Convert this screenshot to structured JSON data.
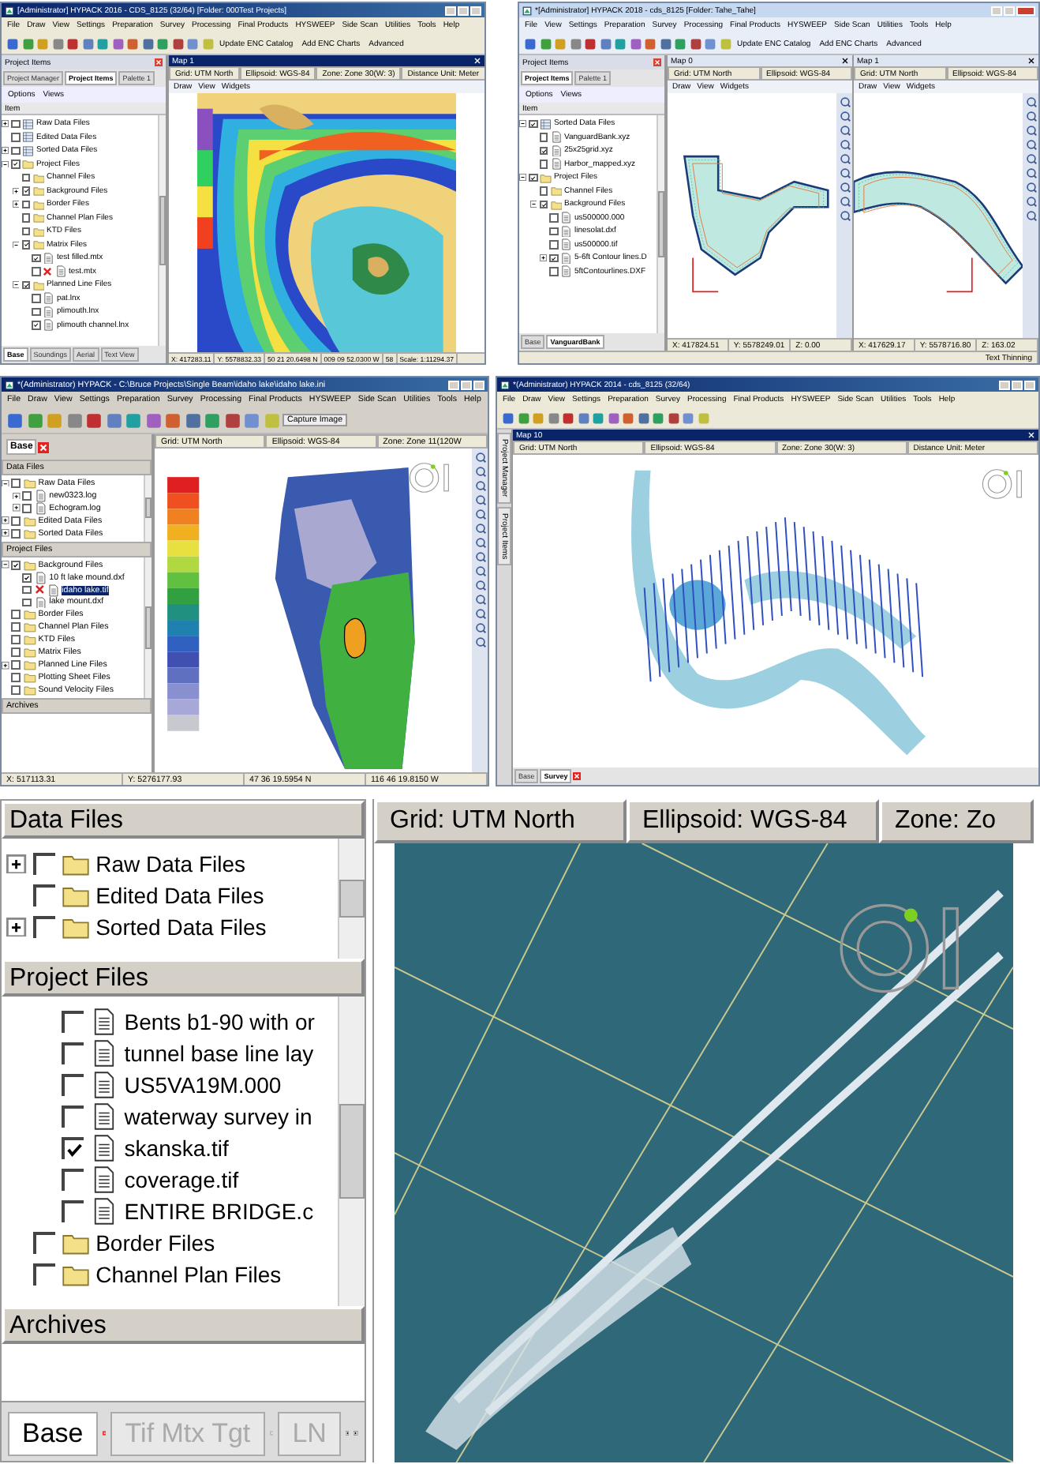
{
  "screens": [
    {
      "kind": "window",
      "title": "[Administrator] HYPACK 2016 - CDS_8125 (32/64) [Folder: 000Test Projects]",
      "menu": [
        "File",
        "Draw",
        "View",
        "Settings",
        "Preparation",
        "Survey",
        "Processing",
        "Final Products",
        "HYSWEEP",
        "Side Scan",
        "Utilities",
        "Tools",
        "Help"
      ],
      "toolbar_labels": [
        "Update ENC Catalog",
        "Add ENC Charts",
        "Advanced"
      ],
      "panel": {
        "title": "Project Items",
        "tabs": [
          {
            "label": "Project Manager",
            "selected": false
          },
          {
            "label": "Project Items",
            "selected": true
          },
          {
            "label": "Palette 1",
            "selected": false
          }
        ],
        "options": [
          "Options",
          "Views"
        ],
        "header": "Item",
        "sections": [
          {
            "tree": [
              {
                "label": "Raw Data Files",
                "kind": "data",
                "checked": false,
                "expanded": false
              },
              {
                "label": "Edited Data Files",
                "kind": "data",
                "checked": false
              },
              {
                "label": "Sorted Data Files",
                "kind": "data",
                "checked": false,
                "expanded": false
              },
              {
                "label": "Project Files",
                "kind": "folder",
                "checked": true,
                "expanded": true,
                "children": [
                  {
                    "label": "Channel Files",
                    "kind": "folder",
                    "checked": false
                  },
                  {
                    "label": "Background Files",
                    "kind": "folder",
                    "checked": true,
                    "expanded": false
                  },
                  {
                    "label": "Border Files",
                    "kind": "folder",
                    "checked": false,
                    "expanded": false
                  },
                  {
                    "label": "Channel Plan Files",
                    "kind": "folder",
                    "checked": false
                  },
                  {
                    "label": "KTD Files",
                    "kind": "folder",
                    "checked": false
                  },
                  {
                    "label": "Matrix Files",
                    "kind": "folder",
                    "checked": true,
                    "expanded": true,
                    "children": [
                      {
                        "label": "test filled.mtx",
                        "kind": "file",
                        "checked": true
                      },
                      {
                        "label": "test.mtx",
                        "kind": "file",
                        "checked": false,
                        "missing": true
                      }
                    ]
                  },
                  {
                    "label": "Planned Line Files",
                    "kind": "folder",
                    "checked": true,
                    "expanded": true,
                    "children": [
                      {
                        "label": "pat.lnx",
                        "kind": "file",
                        "checked": false
                      },
                      {
                        "label": "plimouth.lnx",
                        "kind": "file",
                        "checked": false
                      },
                      {
                        "label": "plimouth channel.lnx",
                        "kind": "file",
                        "checked": true
                      }
                    ]
                  }
                ]
              }
            ]
          }
        ],
        "bottom_tabs": [
          {
            "label": "Base",
            "selected": true
          },
          {
            "label": "Soundings",
            "selected": false
          },
          {
            "label": "Aerial",
            "selected": false
          },
          {
            "label": "Text View",
            "selected": false
          }
        ]
      },
      "maps": [
        {
          "title": "Map 1",
          "fields": [
            "Grid: UTM North",
            "Ellipsoid: WGS-84",
            "Zone: Zone 30(W: 3)",
            "Distance Unit: Meter"
          ],
          "tools": [
            "Draw",
            "View",
            "Widgets"
          ],
          "kind": "depth",
          "status": [
            "X: 417283.11",
            "Y: 5578832.33",
            "50 21 20.6498 N",
            "009 09 52.0300 W",
            "58",
            "Scale: 1:11294.37"
          ]
        }
      ]
    },
    {
      "kind": "window",
      "title": "*[Administrator] HYPACK 2018 - cds_8125 [Folder: Tahe_Tahe]",
      "menu": [
        "File",
        "View",
        "Settings",
        "Preparation",
        "Survey",
        "Processing",
        "Final Products",
        "HYSWEEP",
        "Side Scan",
        "Utilities",
        "Tools",
        "Help"
      ],
      "toolbar_labels": [
        "Update ENC Catalog",
        "Add ENC Charts",
        "Advanced"
      ],
      "panel": {
        "title": "Project Items",
        "tabs": [
          {
            "label": "Project Items",
            "selected": true
          },
          {
            "label": "Palette 1",
            "selected": false
          }
        ],
        "options": [
          "Options",
          "Views"
        ],
        "header": "Item",
        "sections": [
          {
            "tree": [
              {
                "label": "Sorted Data Files",
                "kind": "data",
                "checked": true,
                "expanded": true,
                "children": [
                  {
                    "label": "VanguardBank.xyz",
                    "kind": "file",
                    "checked": false
                  },
                  {
                    "label": "25x25grid.xyz",
                    "kind": "file",
                    "checked": true
                  },
                  {
                    "label": "Harbor_mapped.xyz",
                    "kind": "file",
                    "checked": false
                  }
                ]
              },
              {
                "label": "Project Files",
                "kind": "folder",
                "checked": true,
                "expanded": true,
                "children": [
                  {
                    "label": "Channel Files",
                    "kind": "folder",
                    "checked": false
                  },
                  {
                    "label": "Background Files",
                    "kind": "folder",
                    "checked": true,
                    "expanded": true,
                    "children": [
                      {
                        "label": "us500000.000",
                        "kind": "file",
                        "checked": false
                      },
                      {
                        "label": "linesolat.dxf",
                        "kind": "file",
                        "checked": false
                      },
                      {
                        "label": "us500000.tif",
                        "kind": "file",
                        "checked": false
                      },
                      {
                        "label": "5-6ft Contour lines.D",
                        "kind": "file",
                        "checked": true,
                        "expanded": false
                      },
                      {
                        "label": "5ftContourlines.DXF",
                        "kind": "file",
                        "checked": false
                      }
                    ]
                  }
                ]
              }
            ]
          }
        ],
        "bottom_tabs": [
          {
            "label": "Base",
            "selected": false
          },
          {
            "label": "VanguardBank",
            "selected": true
          }
        ]
      },
      "maps": [
        {
          "title": "Map 0",
          "fields": [
            "Grid: UTM North",
            "Ellipsoid: WGS-84"
          ],
          "tools": [
            "Draw",
            "View",
            "Widgets"
          ],
          "kind": "contour",
          "status": [
            "X: 417824.51",
            "Y: 5578249.01",
            "Z: 0.00"
          ]
        },
        {
          "title": "Map 1",
          "fields": [
            "Grid: UTM North",
            "Ellipsoid: WGS-84"
          ],
          "tools": [
            "Draw",
            "View",
            "Widgets"
          ],
          "kind": "contour",
          "status": [
            "X: 417629.17",
            "Y: 5578716.80",
            "Z: 163.02"
          ]
        }
      ],
      "status": [
        "Text Thinning"
      ]
    },
    {
      "kind": "window",
      "title": "*(Administrator) HYPACK - C:\\Bruce Projects\\Single Beam\\idaho lake\\idaho lake.ini",
      "menu": [
        "File",
        "Draw",
        "View",
        "Settings",
        "Preparation",
        "Survey",
        "Processing",
        "Final Products",
        "HYSWEEP",
        "Side Scan",
        "Utilities",
        "Tools",
        "Help"
      ],
      "toolbar_labels": [
        "Capture Image"
      ],
      "panel": {
        "tabs": [
          {
            "label": "Base",
            "selected": true,
            "close": true
          }
        ],
        "sections": [
          {
            "title": "Data Files",
            "tree": [
              {
                "label": "Raw Data Files",
                "kind": "folder",
                "checked": false,
                "expanded": true,
                "children": [
                  {
                    "label": "new0323.log",
                    "kind": "file",
                    "checked": false,
                    "expanded": false
                  },
                  {
                    "label": "Echogram.log",
                    "kind": "file",
                    "checked": false,
                    "expanded": false
                  }
                ]
              },
              {
                "label": "Edited Data Files",
                "kind": "folder",
                "checked": false,
                "expanded": false
              },
              {
                "label": "Sorted Data Files",
                "kind": "folder",
                "checked": false,
                "expanded": false
              }
            ]
          },
          {
            "title": "Project Files",
            "tree": [
              {
                "label": "Background Files",
                "kind": "folder",
                "checked": true,
                "expanded": true,
                "selected": false,
                "children": [
                  {
                    "label": "10 ft lake mound.dxf",
                    "kind": "file",
                    "checked": true,
                    "selected": false
                  },
                  {
                    "label": "idaho lake.tif",
                    "kind": "file",
                    "checked": false,
                    "missing": true,
                    "selected": true
                  },
                  {
                    "label": "lake mount.dxf",
                    "kind": "file",
                    "checked": false,
                    "selected": false
                  }
                ]
              },
              {
                "label": "Border Files",
                "kind": "folder",
                "checked": false,
                "selected": false
              },
              {
                "label": "Channel Plan Files",
                "kind": "folder",
                "checked": false,
                "selected": false
              },
              {
                "label": "KTD Files",
                "kind": "folder",
                "checked": false,
                "selected": false
              },
              {
                "label": "Matrix Files",
                "kind": "folder",
                "checked": false,
                "selected": false
              },
              {
                "label": "Planned Line Files",
                "kind": "folder",
                "checked": false,
                "expanded": false,
                "selected": false
              },
              {
                "label": "Plotting Sheet Files",
                "kind": "folder",
                "checked": false,
                "selected": false
              },
              {
                "label": "Sound Velocity Files",
                "kind": "folder",
                "checked": false,
                "selected": false
              }
            ]
          },
          {
            "title": "Archives"
          }
        ]
      },
      "maps": [
        {
          "fields": [
            "Grid: UTM North",
            "Ellipsoid: WGS-84",
            "Zone: Zone 11(120W"
          ],
          "kind": "lake"
        }
      ],
      "status": [
        "X: 517113.31",
        "Y: 5276177.93",
        "47 36 19.5954 N",
        "116 46 19.8150 W"
      ]
    },
    {
      "kind": "window",
      "title": "*(Administrator) HYPACK 2014 - cds_8125 (32/64)",
      "menu": [
        "File",
        "Draw",
        "View",
        "Settings",
        "Preparation",
        "Survey",
        "Processing",
        "Final Products",
        "HYSWEEP",
        "Side Scan",
        "Utilities",
        "Tools",
        "Help"
      ],
      "side_tabs": [
        "Project Manager",
        "Project Items"
      ],
      "maps": [
        {
          "title": "Map 10",
          "fields": [
            "Grid: UTM North",
            "Ellipsoid: WGS-84",
            "Zone: Zone 30(W: 3)",
            "Distance Unit: Meter"
          ],
          "kind": "survey",
          "tabs": [
            {
              "label": "Base",
              "selected": false
            },
            {
              "label": "Survey",
              "selected": true,
              "close": true
            }
          ]
        }
      ]
    },
    {
      "kind": "fragment",
      "panel": {
        "sections": [
          {
            "title": "Data Files",
            "tree": [
              {
                "label": "Raw Data Files",
                "kind": "folder",
                "checked": false,
                "expanded": false
              },
              {
                "label": "Edited Data Files",
                "kind": "folder",
                "checked": false
              },
              {
                "label": "Sorted Data Files",
                "kind": "folder",
                "checked": false,
                "expanded": false
              }
            ]
          },
          {
            "title": "Project Files",
            "tree": [
              {
                "children": [
                  {
                    "label": "Bents b1-90 with or",
                    "kind": "file",
                    "checked": false
                  },
                  {
                    "label": "tunnel base line lay",
                    "kind": "file",
                    "checked": false
                  },
                  {
                    "label": "US5VA19M.000",
                    "kind": "file",
                    "checked": false
                  },
                  {
                    "label": "waterway survey in",
                    "kind": "file",
                    "checked": false
                  },
                  {
                    "label": "skanska.tif",
                    "kind": "file",
                    "checked": true
                  },
                  {
                    "label": "coverage.tif",
                    "kind": "file",
                    "checked": false
                  },
                  {
                    "label": "ENTIRE BRIDGE.c",
                    "kind": "file",
                    "checked": false
                  }
                ]
              },
              {
                "label": "Border Files",
                "kind": "folder",
                "checked": false
              },
              {
                "label": "Channel Plan Files",
                "kind": "folder",
                "checked": false
              }
            ]
          },
          {
            "title": "Archives"
          }
        ],
        "bottom_tabs": [
          {
            "label": "Base",
            "selected": true,
            "close": true
          },
          {
            "label": "Tif Mtx Tgt",
            "selected": false,
            "close": true
          },
          {
            "label": "LN",
            "selected": false
          }
        ]
      },
      "maps": [
        {
          "fields": [
            "Grid: UTM North",
            "Ellipsoid: WGS-84",
            "Zone: Zo"
          ],
          "kind": "aerial"
        }
      ]
    }
  ]
}
